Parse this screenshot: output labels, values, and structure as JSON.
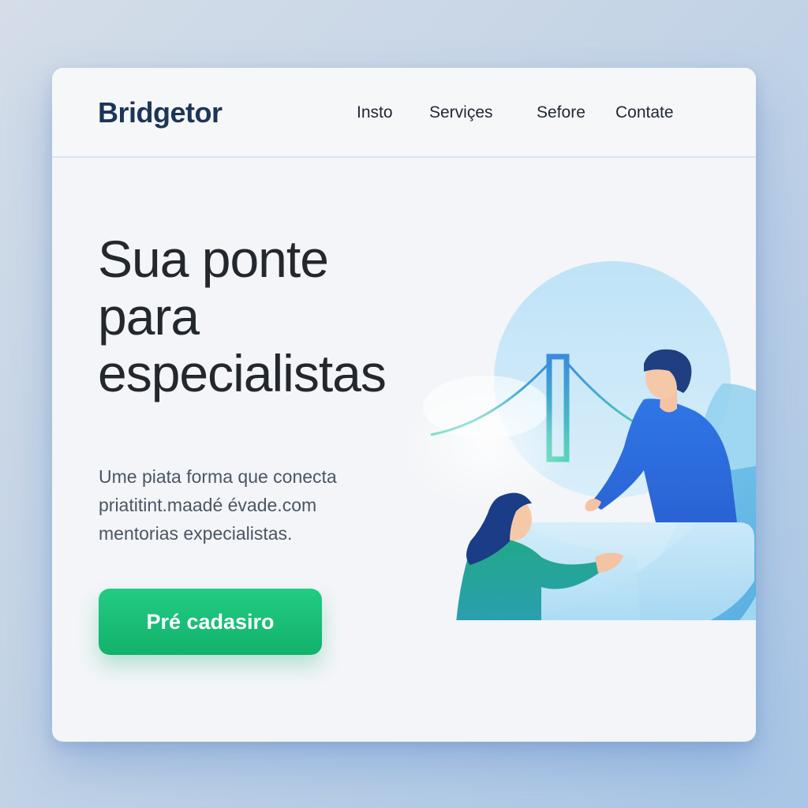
{
  "nav": {
    "logo": "Bridgetor",
    "links": [
      "Insto",
      "Serviçes",
      "Sefore",
      "Contate"
    ]
  },
  "hero": {
    "title_lines": [
      "Sua ponte",
      "para",
      "especialistas"
    ],
    "subtitle_lines": [
      "Ume piata forma que conecta",
      "priatitint.maadé évade.com",
      "mentorias expecialistas."
    ]
  },
  "cta": {
    "label": "Pré  cadasiro"
  },
  "colors": {
    "brand": "#1d3557",
    "cta": "#1dbf78",
    "accent_blue": "#2f6fe0",
    "accent_teal": "#1fa98a"
  },
  "illustration": {
    "icons": [
      "bridge-icon",
      "man-figure",
      "woman-figure"
    ]
  }
}
